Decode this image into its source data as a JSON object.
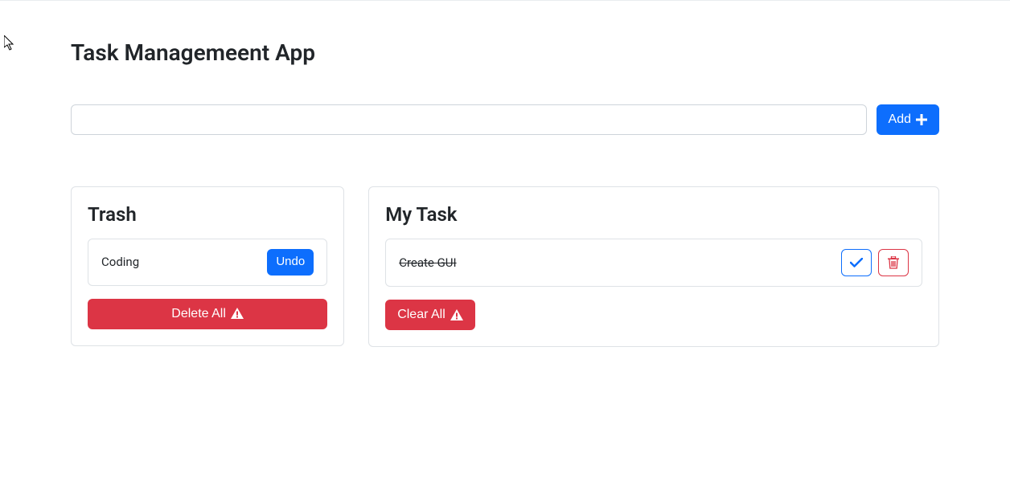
{
  "app": {
    "title": "Task Managemeent App"
  },
  "input": {
    "value": "",
    "placeholder": ""
  },
  "buttons": {
    "add": "Add",
    "undo": "Undo",
    "delete_all": "Delete All",
    "clear_all": "Clear All"
  },
  "trash": {
    "title": "Trash",
    "items": [
      {
        "text": "Coding"
      }
    ]
  },
  "tasks": {
    "title": "My Task",
    "items": [
      {
        "text": "Create GUI",
        "completed": true
      }
    ]
  }
}
